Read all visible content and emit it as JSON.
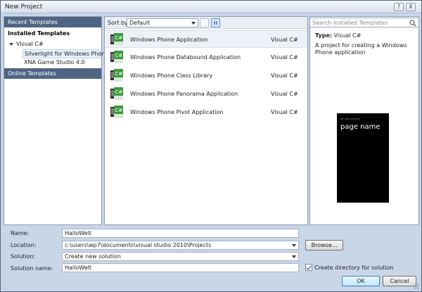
{
  "window": {
    "title": "New Project",
    "controls": [
      "?",
      "X"
    ]
  },
  "left": {
    "recent": "Recent Templates",
    "installed": "Installed Templates",
    "tree": [
      {
        "label": "Visual C#",
        "expanded": true
      },
      {
        "label": "Silverlight for Windows Phone",
        "selected": true
      },
      {
        "label": "XNA Game Studio 4.0"
      }
    ],
    "online": "Online Templates"
  },
  "sort": {
    "label": "Sort by:",
    "value": "Default"
  },
  "templates": [
    {
      "name": "Windows Phone Application",
      "lang": "Visual C#",
      "selected": true
    },
    {
      "name": "Windows Phone Databound Application",
      "lang": "Visual C#"
    },
    {
      "name": "Windows Phone Class Library",
      "lang": "Visual C#"
    },
    {
      "name": "Windows Phone Panorama Application",
      "lang": "Visual C#"
    },
    {
      "name": "Windows Phone Pivot Application",
      "lang": "Visual C#"
    }
  ],
  "search": {
    "placeholder": "Search Installed Templates"
  },
  "details": {
    "type_label": "Type:",
    "type_value": "Visual C#",
    "description": "A project for creating a Windows Phone application",
    "preview_small": "MY APPLICATION",
    "preview_big": "page name"
  },
  "form": {
    "name_label": "Name:",
    "name_value": "HalloWelt",
    "location_label": "Location:",
    "location_value": "c:\\users\\wp7\\documents\\visual studio 2010\\Projects",
    "solution_label": "Solution:",
    "solution_value": "Create new solution",
    "solution_name_label": "Solution name:",
    "solution_name_value": "HalloWelt",
    "browse": "Browse...",
    "create_dir": "Create directory for solution",
    "ok": "OK",
    "cancel": "Cancel"
  },
  "colors": {
    "accent": "#4f6483",
    "frame": "#c9d6e8",
    "icon_green": "#3a9b3a"
  }
}
